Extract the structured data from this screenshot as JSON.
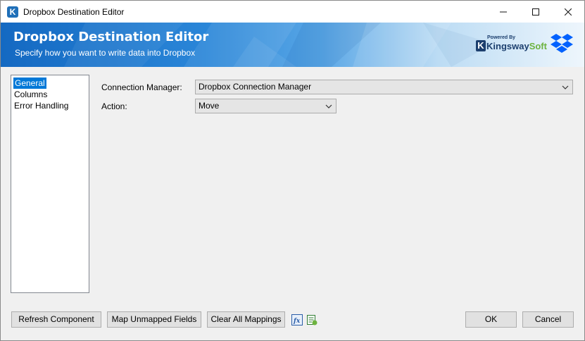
{
  "window": {
    "title": "Dropbox Destination Editor"
  },
  "banner": {
    "title": "Dropbox Destination Editor",
    "subtitle": "Specify how you want to write data into Dropbox",
    "brand_powered": "Powered By",
    "brand_name_a": "Kingsway",
    "brand_name_b": "Soft",
    "brand_k": "K"
  },
  "nav": {
    "items": [
      {
        "label": "General",
        "selected": true
      },
      {
        "label": "Columns",
        "selected": false
      },
      {
        "label": "Error Handling",
        "selected": false
      }
    ]
  },
  "form": {
    "connection_manager_label": "Connection Manager:",
    "connection_manager_value": "Dropbox Connection Manager",
    "action_label": "Action:",
    "action_value": "Move"
  },
  "footer": {
    "refresh_label": "Refresh Component",
    "map_unmapped_label": "Map Unmapped Fields",
    "clear_mappings_label": "Clear All Mappings",
    "ok_label": "OK",
    "cancel_label": "Cancel"
  },
  "icons": {
    "app": "kingswaysoft-app-icon",
    "minimize": "minimize-icon",
    "maximize": "maximize-icon",
    "close": "close-icon",
    "dropbox": "dropbox-logo-icon",
    "expression": "fx-expression-icon",
    "mapping": "mapping-sheet-icon"
  },
  "colors": {
    "selection": "#0078d7",
    "banner_start": "#1469c2",
    "brand_dark": "#1c3f6e",
    "brand_green": "#6db33f",
    "dropbox_blue": "#0061fe"
  }
}
